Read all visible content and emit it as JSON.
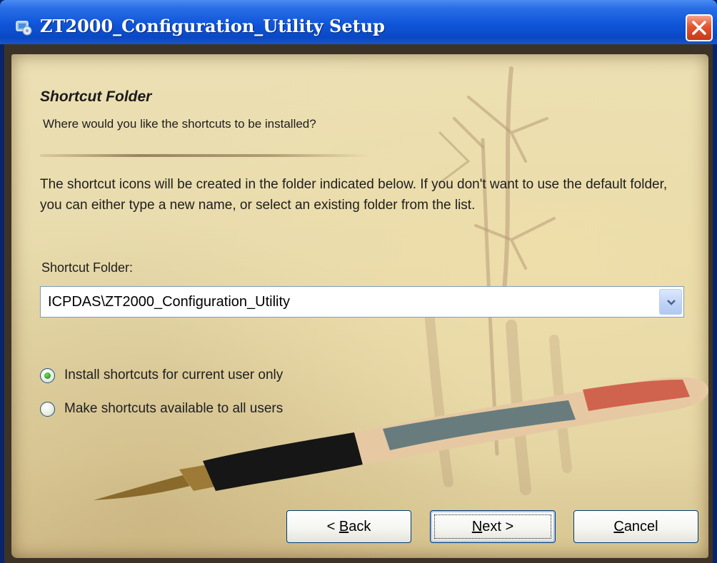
{
  "window": {
    "title": "ZT2000_Configuration_Utility Setup"
  },
  "page": {
    "heading": "Shortcut Folder",
    "subheading": "Where would you like the shortcuts to be installed?",
    "description": "The shortcut icons will be created in the folder indicated below. If you don't want to use the default folder, you can either type a new name, or select an existing folder from the list."
  },
  "shortcut_folder": {
    "label": "Shortcut Folder:",
    "value": "ICPDAS\\ZT2000_Configuration_Utility"
  },
  "options": [
    {
      "label": "Install shortcuts for current user only",
      "selected": true
    },
    {
      "label": "Make shortcuts available to all users",
      "selected": false
    }
  ],
  "buttons": {
    "back": {
      "prefix": "< ",
      "accel": "B",
      "rest": "ack"
    },
    "next": {
      "prefix": "",
      "accel": "N",
      "rest": "ext >"
    },
    "cancel": {
      "prefix": "",
      "accel": "C",
      "rest": "ancel"
    }
  },
  "colors": {
    "titlebar": "#0a48c4",
    "close": "#e2552e",
    "paper": "#e8dbac",
    "radio_selected": "#2f9e20"
  },
  "icons": {
    "app": "installer-icon",
    "close": "close-icon",
    "dropdown": "chevron-down-icon"
  }
}
